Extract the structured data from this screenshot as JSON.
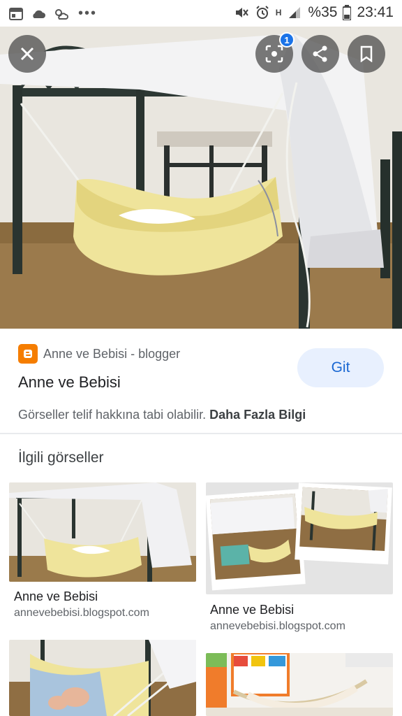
{
  "status_bar": {
    "battery": "%35",
    "time": "23:41",
    "icons": [
      "calendar-icon",
      "cloud-icon",
      "weather-icon",
      "more-icon",
      "mute-icon",
      "alarm-icon",
      "signal-h-icon",
      "signal-icon",
      "battery-icon"
    ]
  },
  "hero": {
    "lens_badge": "1",
    "icons": [
      "close-icon",
      "lens-icon",
      "share-icon",
      "bookmark-icon"
    ]
  },
  "source": {
    "site": "Anne ve Bebisi - blogger",
    "title": "Anne ve Bebisi",
    "visit_label": "Git",
    "copyright_text": "Görseller telif hakkına tabi olabilir.",
    "more_info_label": "Daha Fazla Bilgi",
    "accent": "#1967d2",
    "blogger_color": "#f57d00"
  },
  "related": {
    "heading": "İlgili görseller",
    "items": [
      {
        "title": "Anne ve Bebisi",
        "url": "annevebebisi.blogspot.com"
      },
      {
        "title": "Anne ve Bebisi",
        "url": "annevebebisi.blogspot.com"
      },
      {
        "title": "",
        "url": ""
      },
      {
        "title": "",
        "url": ""
      }
    ]
  }
}
